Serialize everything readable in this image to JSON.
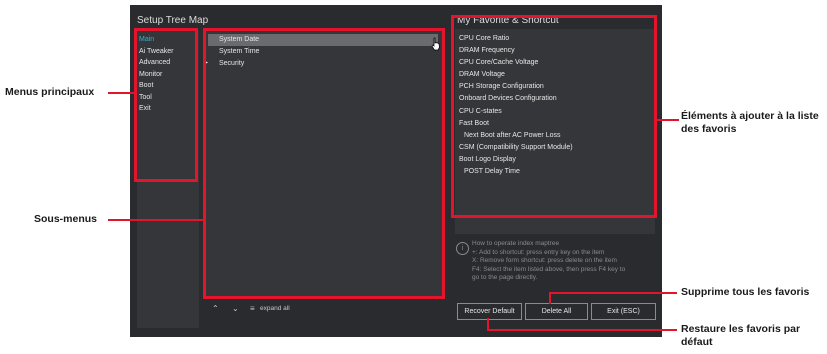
{
  "setup_tree_title": "Setup Tree Map",
  "favorite_title": "My Favorite & Shortcut",
  "main_menus": [
    "Main",
    "Ai Tweaker",
    "Advanced",
    "Monitor",
    "Boot",
    "Tool",
    "Exit"
  ],
  "sub_menus": [
    {
      "label": "System Date",
      "arrow": ""
    },
    {
      "label": "System Time",
      "arrow": ""
    },
    {
      "label": "Security",
      "arrow": "▸"
    }
  ],
  "favorites": [
    "CPU Core Ratio",
    "DRAM Frequency",
    "CPU Core/Cache Voltage",
    "DRAM Voltage",
    "PCH Storage Configuration",
    "Onboard Devices Configuration",
    "CPU C-states",
    "Fast Boot",
    "  Next Boot after AC Power Loss",
    "CSM (Compatibility Support Module)",
    "Boot Logo Display",
    "  POST Delay Time"
  ],
  "help": {
    "icon": "i",
    "lines": [
      "How to operate index maptree",
      "+: Add to shortcut: press entry key on the item",
      "X: Remove form shortcut: press delete on the item",
      "F4: Select the item listed above, then press F4 key to",
      "go to the page directly."
    ]
  },
  "buttons": {
    "recover": "Recover Default",
    "delete_all": "Delete All",
    "exit": "Exit (ESC)"
  },
  "bottom_bar": {
    "up": "≈",
    "down": "≈",
    "expand_icon": "≡",
    "expand_label": "expand all"
  },
  "callouts": {
    "main_menus": "Menus principaux",
    "sub_menus": "Sous-menus",
    "favorites_line1": "Éléments à ajouter à la liste",
    "favorites_line2": "des favoris",
    "delete_all_desc": "Supprime tous les favoris",
    "restore_line1": "Restaure les favoris par",
    "restore_line2": "défaut"
  },
  "colors": {
    "accent_selected_menu": "#2bb5d6",
    "annotation_red": "#e5142d"
  }
}
